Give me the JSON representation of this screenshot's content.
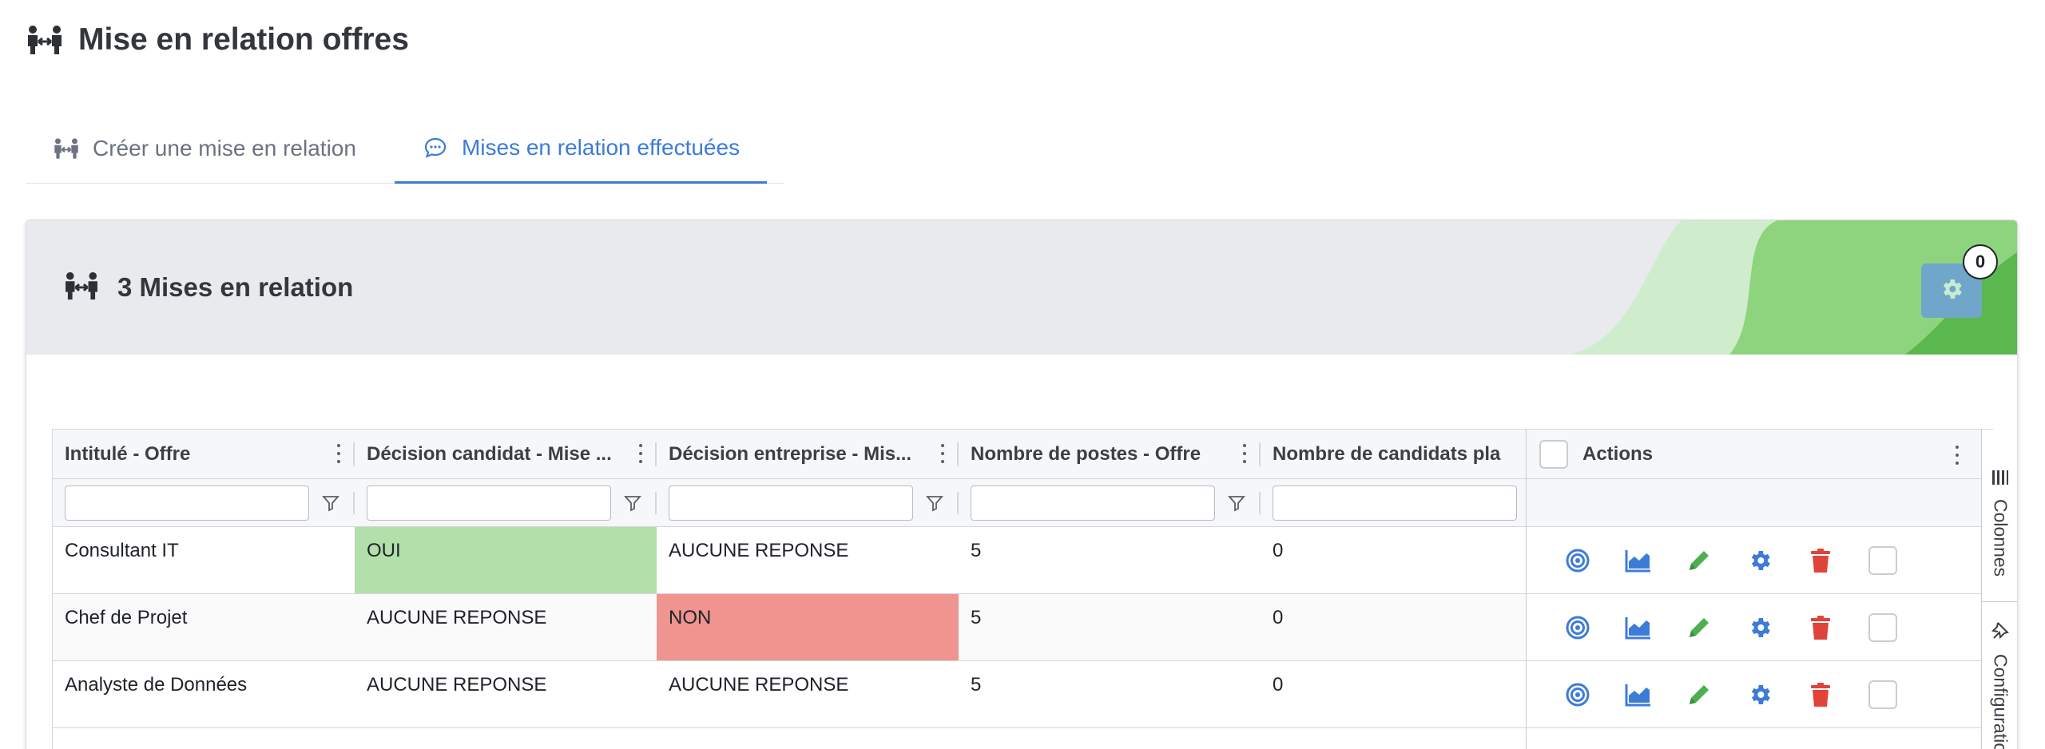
{
  "page": {
    "title": "Mise en relation offres",
    "icon": "people-arrows-icon"
  },
  "tabs": [
    {
      "label": "Créer une mise en relation",
      "icon": "people-arrows-icon",
      "active": false
    },
    {
      "label": "Mises en relation effectuées",
      "icon": "comment-dots-icon",
      "active": true
    }
  ],
  "card": {
    "title": "3 Mises en relation",
    "icon": "people-arrows-icon",
    "settings_badge": "0"
  },
  "grid": {
    "columns": [
      "Intitulé - Offre",
      "Décision candidat - Mise ...",
      "Décision entreprise - Mis...",
      "Nombre de postes - Offre",
      "Nombre de candidats pla"
    ],
    "actions_header": "Actions",
    "rows": [
      {
        "cells": [
          "Consultant IT",
          "OUI",
          "AUCUNE REPONSE",
          "5",
          "0"
        ]
      },
      {
        "cells": [
          "Chef de Projet",
          "AUCUNE REPONSE",
          "NON",
          "5",
          "0"
        ]
      },
      {
        "cells": [
          "Analyste de Données",
          "AUCUNE REPONSE",
          "AUCUNE REPONSE",
          "5",
          "0"
        ]
      }
    ],
    "row_actions": [
      "target-icon",
      "chart-area-icon",
      "pencil-icon",
      "gear-icon",
      "trash-icon",
      "select-checkbox"
    ],
    "side_panel": [
      "Colonnes",
      "Configuration"
    ]
  },
  "colors": {
    "accent": "#3d7bd8",
    "oui": "#b2dfaa",
    "non": "#ef948f",
    "edit": "#4caf50",
    "delete": "#e0433a"
  }
}
